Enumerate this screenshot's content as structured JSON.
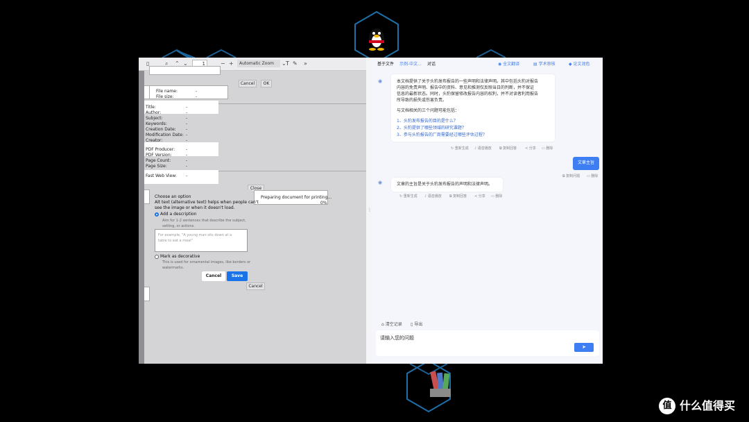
{
  "pdf": {
    "toolbar": {
      "page_number": "1",
      "zoom": "Automatic Zoom"
    },
    "top_dialog": {
      "cancel": "Cancel",
      "ok": "OK"
    },
    "file_card": {
      "file_name_label": "File name:",
      "file_name_value": "-",
      "file_size_label": "File size:",
      "file_size_value": "-"
    },
    "properties": [
      {
        "label": "Title:",
        "value": "-"
      },
      {
        "label": "Author:",
        "value": "-"
      },
      {
        "label": "Subject:",
        "value": "-"
      },
      {
        "label": "Keywords:",
        "value": "-"
      },
      {
        "label": "Creation Date:",
        "value": "-"
      },
      {
        "label": "Modification Date:",
        "value": "-"
      },
      {
        "label": "Creator:",
        "value": "-"
      },
      {
        "label": "PDF Producer:",
        "value": "-"
      },
      {
        "label": "PDF Version:",
        "value": "-"
      },
      {
        "label": "Page Count:",
        "value": "-"
      },
      {
        "label": "Page Size:",
        "value": "-"
      },
      {
        "label": "Fast Web View:",
        "value": "-"
      }
    ],
    "close_button": "Close",
    "printing": {
      "text": "Preparing document for printing…",
      "percent": "0%"
    },
    "alt_dialog": {
      "title": "Choose an option",
      "desc1": "Alt text (alternative text) helps when people can't",
      "desc2": "see the image or when it doesn't load.",
      "option1": "Add a description",
      "option1_hint1": "Aim for 1-2 sentences that describe the subject,",
      "option1_hint2": "setting, or actions.",
      "placeholder1": "For example, \"A young man sits down at a",
      "placeholder2": "table to eat a meal\"",
      "option2": "Mark as decorative",
      "option2_hint1": "This is used for ornamental images, like borders or",
      "option2_hint2": "watermarks.",
      "cancel": "Cancel",
      "save": "Save"
    },
    "bottom_cancel": "Cancel"
  },
  "chat": {
    "header": {
      "based_on": "基于文件",
      "file": "示例-中文...",
      "dialog": "对话",
      "full_translate": "全文翻译",
      "academic_review": "学术审核",
      "paper_polish": "论文润色"
    },
    "message1": {
      "lines": [
        "本文档提供了关于头豹发布报告的一些声明和法律声明。其中包括头豹对报告",
        "内容的免责声明、报告中的资料、意见和推测仅反映当日的判断，并不保证",
        "信息的最新状态。同时，头豹保留修改报告内容的权利，并不对读者利用报告",
        "所导致的损失或伤害负责。"
      ],
      "related_intro": "与文档相关的三个问题可能包括：",
      "questions": [
        "1、头豹发布报告的目的是什么？",
        "2、头豹提供了哪些领域的研究课题？",
        "3、参与头豹报告的厂商需要经过哪些评估过程？"
      ],
      "actions": [
        "重新生成",
        "语音播放",
        "复制回答",
        "分享",
        "删除"
      ]
    },
    "user_message": "文章主旨",
    "user_actions": [
      "复制问题",
      "删除"
    ],
    "message2": {
      "text": "文章的主旨是关于头豹发布报告的声明和法律声明。",
      "actions": [
        "重新生成",
        "语音播放",
        "复制回答",
        "分享",
        "删除"
      ]
    },
    "footer": {
      "clear": "清空记录",
      "export": "导出",
      "input_placeholder": "请输入您的问题"
    }
  },
  "watermark": {
    "text": "什么值得买",
    "logo_char": "值"
  },
  "colors": {
    "accent": "#3d7ff2",
    "hex_border": "#1f6fa8",
    "link": "#3366cc"
  }
}
